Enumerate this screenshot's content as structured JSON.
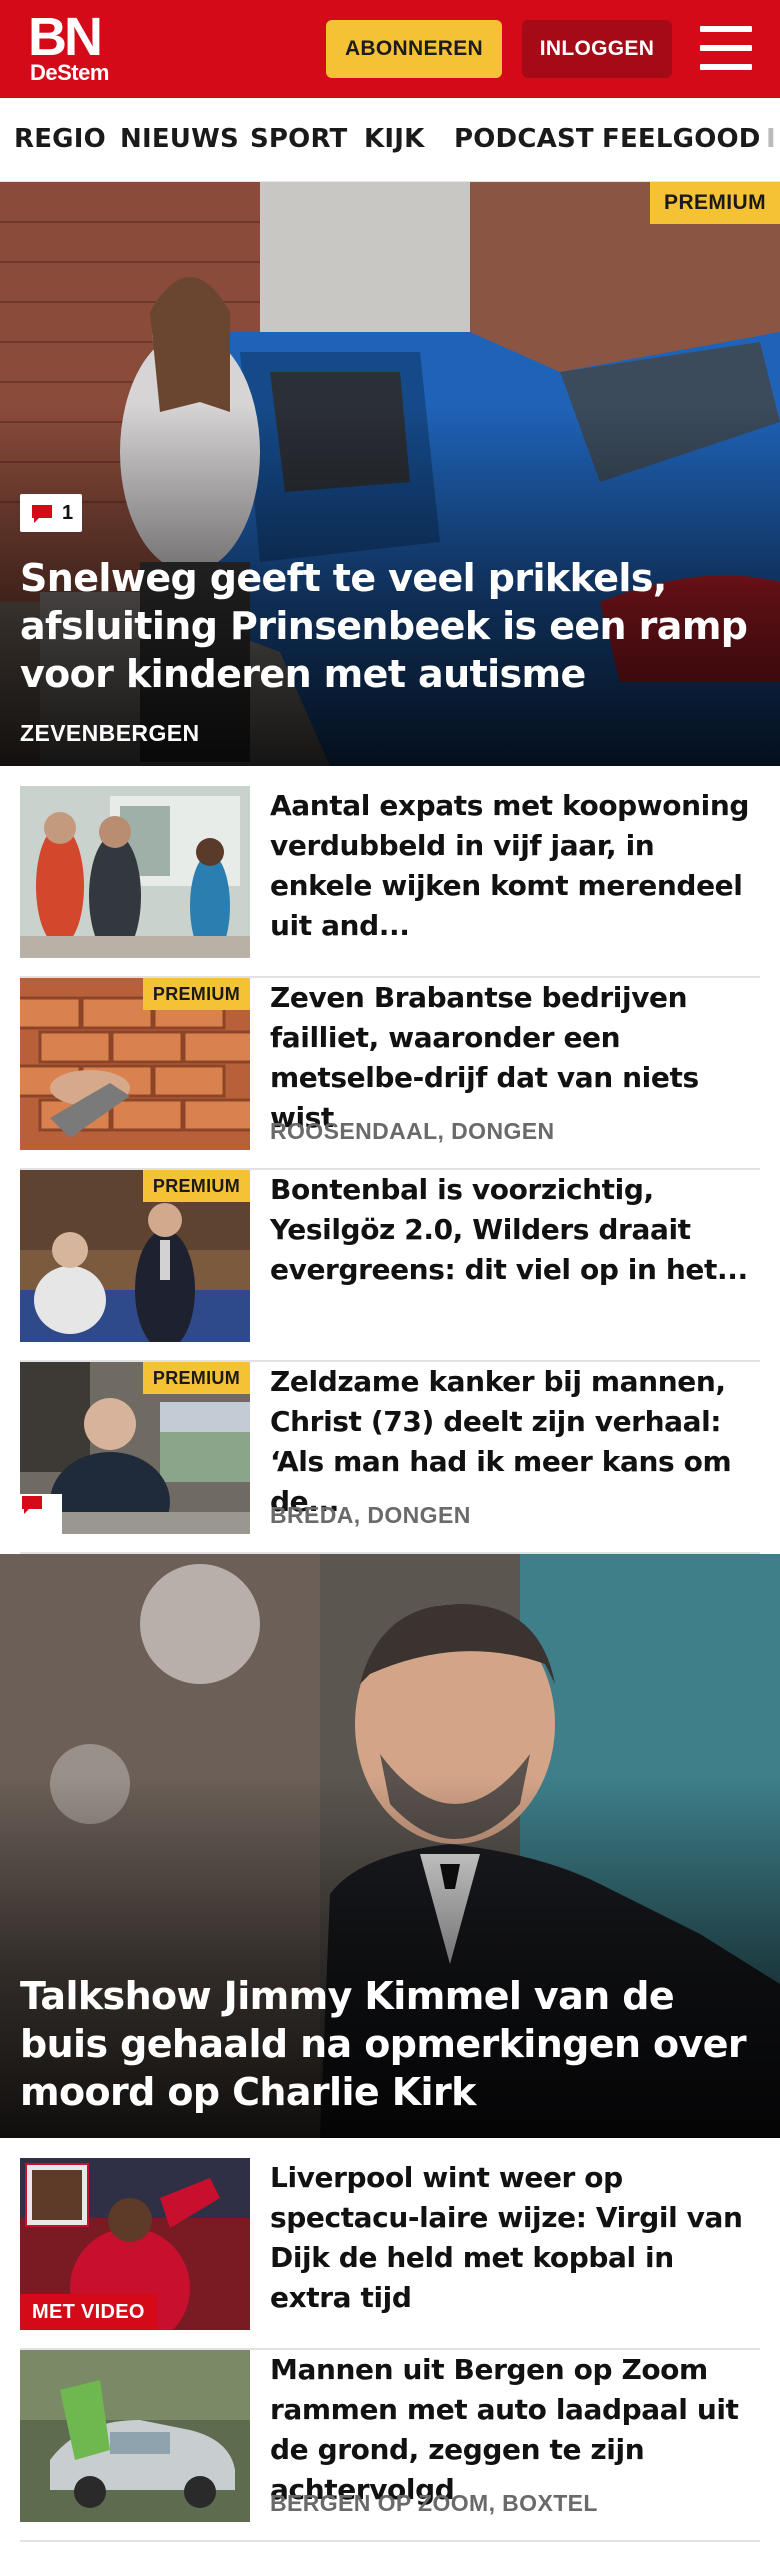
{
  "header": {
    "logo_main": "BN",
    "logo_sub": "DeStem",
    "subscribe_label": "ABONNEREN",
    "login_label": "INLOGGEN",
    "menu_icon": "hamburger-menu-icon",
    "brand_color": "#d40a19",
    "accent_color": "#f6c235"
  },
  "nav": {
    "items": [
      "REGIO",
      "NIEUWS",
      "SPORT",
      "KIJK",
      "PODCAST",
      "FEELGOOD",
      "I"
    ]
  },
  "hero1": {
    "premium_label": "PREMIUM",
    "comment_count": "1",
    "title": "Snelweg geeft te veel prikkels, afsluiting Prinsenbeek is een ramp voor kinderen met autisme",
    "location": "ZEVENBERGEN"
  },
  "articles": [
    {
      "title": "Aantal expats met koopwoning verdubbeld in vijf jaar, in enkele wijken komt merendeel uit and...",
      "location": "",
      "premium": false
    },
    {
      "title": "Zeven Brabantse bedrijven failliet, waaronder een metselbe-drijf dat van niets wist",
      "location": "ROOSENDAAL, DONGEN",
      "premium": true,
      "premium_label": "PREMIUM"
    },
    {
      "title": "Bontenbal is voorzichtig, Yesilgöz 2.0, Wilders draait evergreens: dit viel op in het...",
      "location": "",
      "premium": true,
      "premium_label": "PREMIUM"
    },
    {
      "title": "Zeldzame kanker bij mannen, Christ (73) deelt zijn verhaal: ‘Als man had ik meer kans om de...",
      "location": "BREDA, DONGEN",
      "premium": true,
      "premium_label": "PREMIUM",
      "comment_icon": "comment-icon"
    }
  ],
  "hero2": {
    "title": "Talkshow Jimmy Kimmel van de buis gehaald na opmerkingen over moord op Charlie Kirk"
  },
  "articles2": [
    {
      "title": "Liverpool wint weer op spectacu-laire wijze: Virgil van Dijk de held met kopbal in extra tijd",
      "video_label": "MET VIDEO"
    },
    {
      "title": "Mannen uit Bergen op Zoom rammen met auto laadpaal uit de grond, zeggen te zijn achtervolgd",
      "location": "BERGEN OP ZOOM, BOXTEL"
    }
  ]
}
